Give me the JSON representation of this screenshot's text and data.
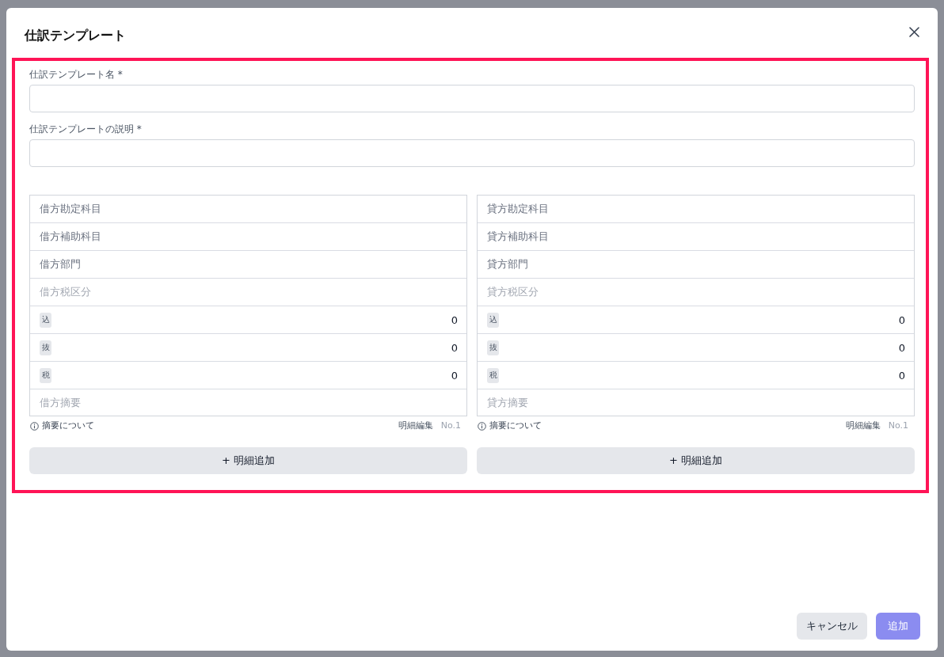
{
  "dialog": {
    "title": "仕訳テンプレート",
    "form": {
      "highlighted": true,
      "fields": [
        {
          "label": "仕訳テンプレート名 *"
        },
        {
          "label": "仕訳テンプレートの説明 *"
        }
      ],
      "entry_columns": [
        {
          "rows": [
            {
              "kind": "select",
              "placeholder": "借方勘定科目",
              "disabled": false
            },
            {
              "kind": "select",
              "placeholder": "借方補助科目",
              "disabled": false
            },
            {
              "kind": "select",
              "placeholder": "借方部門",
              "disabled": false
            },
            {
              "kind": "select",
              "placeholder": "借方税区分",
              "disabled": true
            },
            {
              "kind": "amount",
              "badge": "込",
              "value": "0",
              "disabled": false
            },
            {
              "kind": "amount",
              "badge": "抜",
              "value": "0",
              "disabled": false
            },
            {
              "kind": "amount",
              "badge": "税",
              "value": "0",
              "disabled": false
            },
            {
              "kind": "text",
              "placeholder": "借方摘要",
              "disabled": false
            }
          ],
          "help_link": "摘要について",
          "edit_label": "明細編集",
          "line_number": "No.1",
          "add_button": "+ 明細追加"
        },
        {
          "rows": [
            {
              "kind": "select",
              "placeholder": "貸方勘定科目",
              "disabled": false
            },
            {
              "kind": "select",
              "placeholder": "貸方補助科目",
              "disabled": false
            },
            {
              "kind": "select",
              "placeholder": "貸方部門",
              "disabled": false
            },
            {
              "kind": "select",
              "placeholder": "貸方税区分",
              "disabled": true
            },
            {
              "kind": "amount",
              "badge": "込",
              "value": "0",
              "disabled": false
            },
            {
              "kind": "amount",
              "badge": "抜",
              "value": "0",
              "disabled": false
            },
            {
              "kind": "amount",
              "badge": "税",
              "value": "0",
              "disabled": false
            },
            {
              "kind": "text",
              "placeholder": "貸方摘要",
              "disabled": false
            }
          ],
          "help_link": "摘要について",
          "edit_label": "明細編集",
          "line_number": "No.1",
          "add_button": "+ 明細追加"
        }
      ]
    },
    "actions": [
      {
        "label": "キャンセル",
        "kind": "secondary",
        "disabled": false
      },
      {
        "label": "追加",
        "kind": "primary",
        "disabled": true
      }
    ]
  }
}
